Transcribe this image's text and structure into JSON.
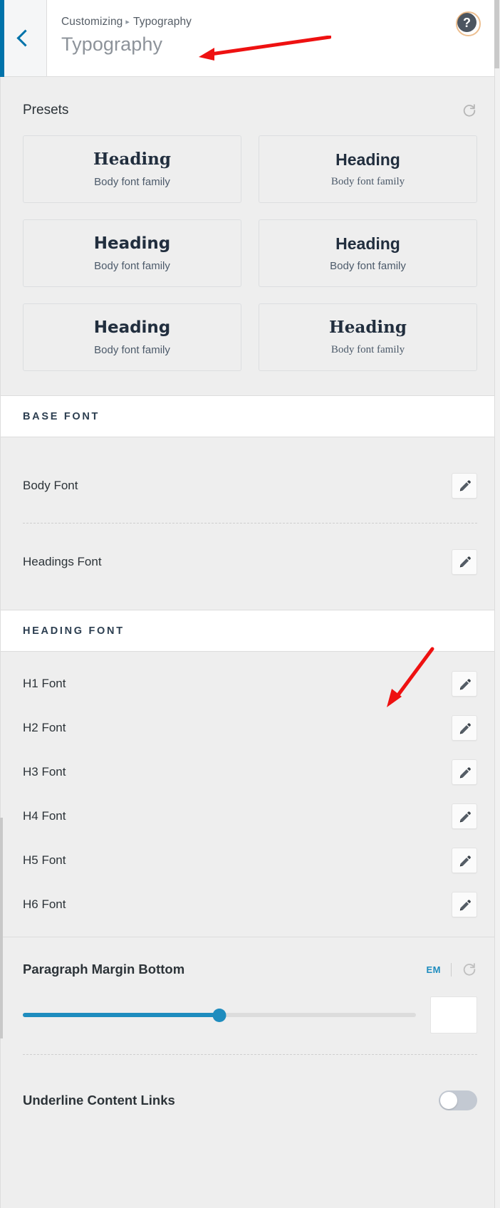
{
  "header": {
    "back_label": "Back",
    "breadcrumb_root": "Customizing",
    "breadcrumb_separator": "▸",
    "breadcrumb_current": "Typography",
    "panel_title": "Typography",
    "help_label": "?"
  },
  "presets": {
    "title": "Presets",
    "reset_label": "Reset",
    "items": [
      {
        "heading": "Heading",
        "body": "Body font family",
        "heading_style": "f-dserif",
        "body_style": "f-sans"
      },
      {
        "heading": "Heading",
        "body": "Body font family",
        "heading_style": "f-sans",
        "body_style": "f-serif"
      },
      {
        "heading": "Heading",
        "body": "Body font family",
        "heading_style": "f-dsans",
        "body_style": "f-sans"
      },
      {
        "heading": "Heading",
        "body": "Body font family",
        "heading_style": "f-sans",
        "body_style": "f-sans"
      },
      {
        "heading": "Heading",
        "body": "Body font family",
        "heading_style": "f-dsans",
        "body_style": "f-sans"
      },
      {
        "heading": "Heading",
        "body": "Body font family",
        "heading_style": "f-dserif",
        "body_style": "f-serif"
      }
    ]
  },
  "base_font": {
    "section_title": "BASE FONT",
    "rows": [
      {
        "label": "Body Font",
        "edit_label": "Edit"
      },
      {
        "label": "Headings Font",
        "edit_label": "Edit"
      }
    ]
  },
  "heading_font": {
    "section_title": "HEADING FONT",
    "rows": [
      {
        "label": "H1 Font",
        "edit_label": "Edit"
      },
      {
        "label": "H2 Font",
        "edit_label": "Edit"
      },
      {
        "label": "H3 Font",
        "edit_label": "Edit"
      },
      {
        "label": "H4 Font",
        "edit_label": "Edit"
      },
      {
        "label": "H5 Font",
        "edit_label": "Edit"
      },
      {
        "label": "H6 Font",
        "edit_label": "Edit"
      }
    ]
  },
  "paragraph_margin": {
    "label": "Paragraph Margin Bottom",
    "unit": "EM",
    "reset_label": "Reset",
    "value": "",
    "placeholder": "",
    "slider_percent": 50
  },
  "underline_links": {
    "label": "Underline Content Links",
    "state": "off"
  },
  "colors": {
    "accent": "#0073aa",
    "slider": "#1e8cbe",
    "panel_bg": "#eeeeee",
    "section_bg": "#ffffff",
    "text": "#2c3338",
    "annotation": "#ee1111"
  }
}
